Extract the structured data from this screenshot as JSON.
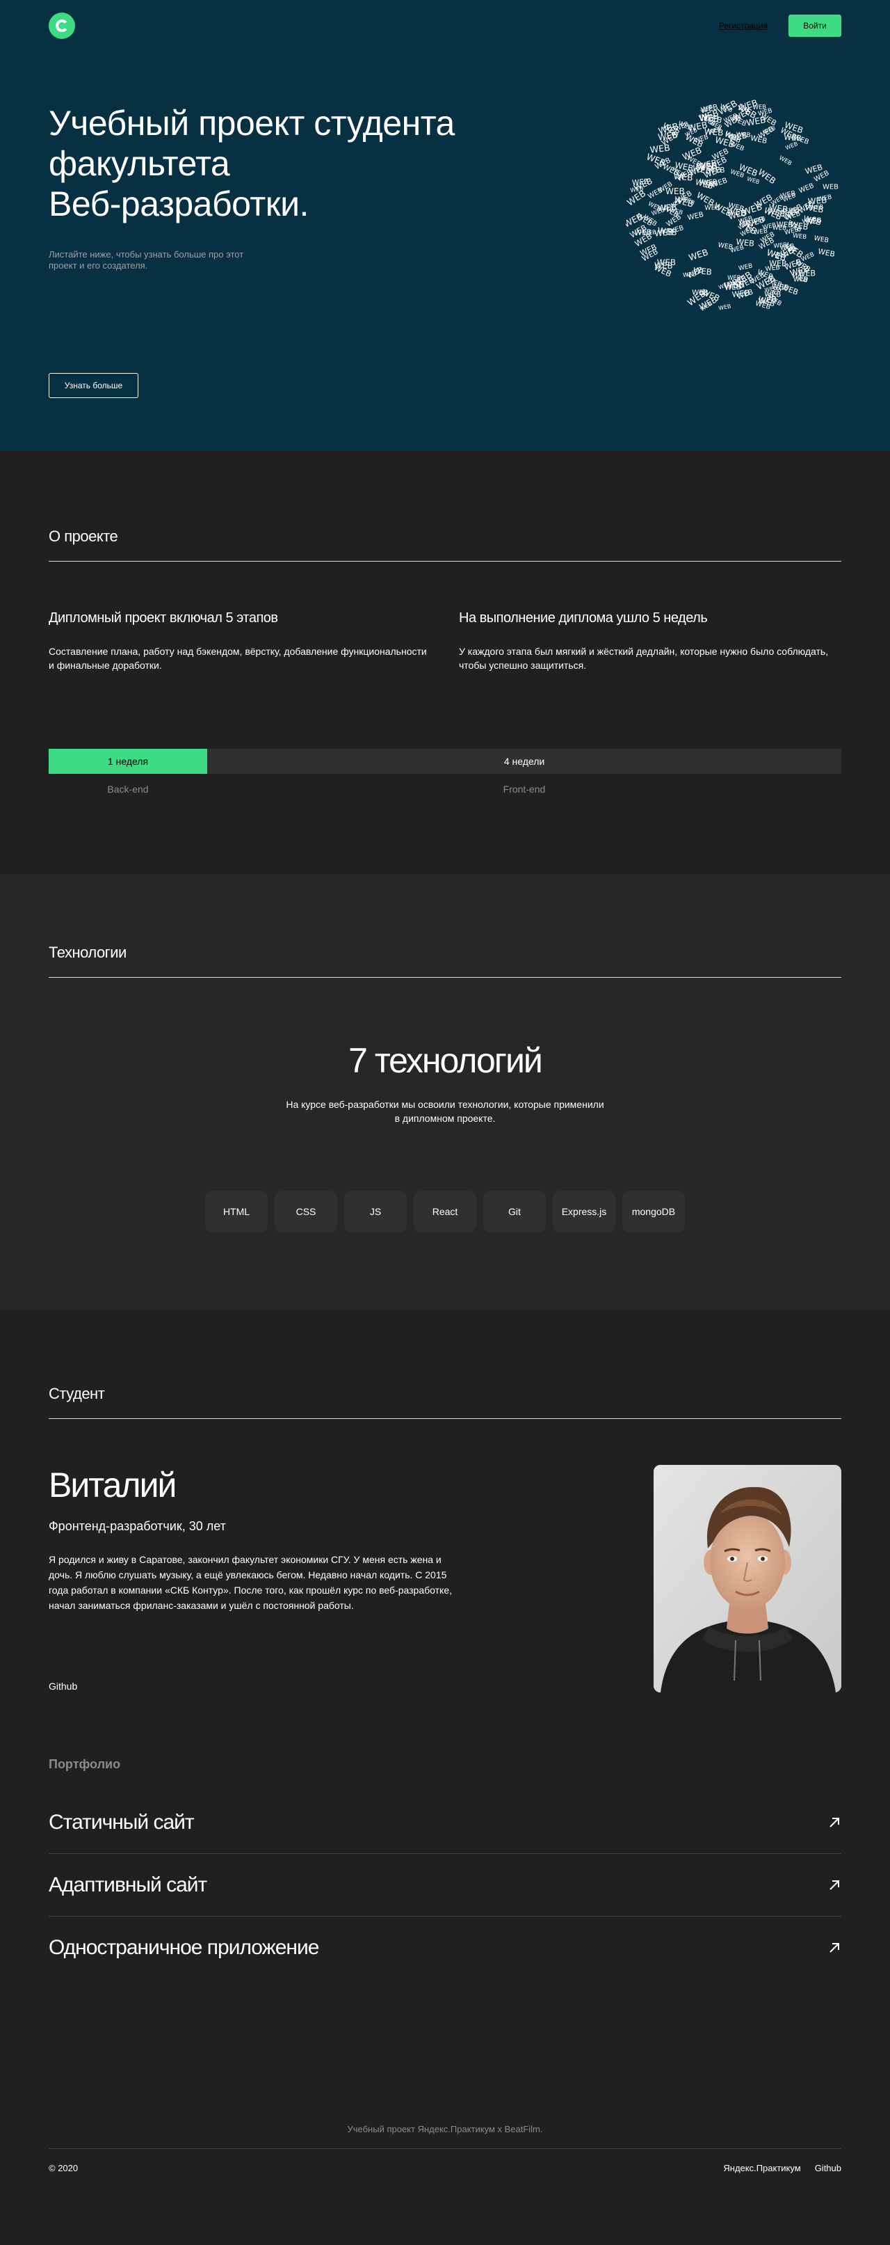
{
  "header": {
    "register_label": "Регистрация",
    "login_label": "Войти"
  },
  "hero": {
    "title_line1": "Учебный проект студента",
    "title_line2": "факультета",
    "title_line3": "Веб-разработки.",
    "subtitle": "Листайте ниже, чтобы узнать больше про этот проект и его создателя.",
    "button_label": "Узнать больше",
    "art_word": "WEB"
  },
  "about": {
    "title": "О проекте",
    "col1_title": "Дипломный проект включал 5 этапов",
    "col1_text": "Составление плана, работу над бэкендом, вёрстку, добавление функциональности и финальные доработки.",
    "col2_title": "На выполнение диплома ушло 5 недель",
    "col2_text": "У каждого этапа был мягкий и жёсткий дедлайн, которые нужно было соблюдать, чтобы успешно защититься.",
    "timeline": {
      "back_duration": "1 неделя",
      "back_label": "Back-end",
      "front_duration": "4 недели",
      "front_label": "Front-end"
    }
  },
  "tech": {
    "title": "Технологии",
    "headline": "7 технологий",
    "text": "На курсе веб-разработки мы освоили технологии, которые применили в дипломном проекте.",
    "items": [
      "HTML",
      "CSS",
      "JS",
      "React",
      "Git",
      "Express.js",
      "mongoDB"
    ]
  },
  "student": {
    "title": "Студент",
    "name": "Виталий",
    "job": "Фронтенд-разработчик, 30 лет",
    "bio": "Я родился и живу в Саратове, закончил факультет экономики СГУ. У меня есть жена и дочь. Я люблю слушать музыку, а ещё увлекаюсь бегом. Недавно начал кодить. С 2015 года работал в компании «СКБ Контур». После того, как прошёл курс по веб-разработке, начал заниматься фриланс-заказами и ушёл с постоянной работы.",
    "github_label": "Github"
  },
  "portfolio": {
    "title": "Портфолио",
    "items": [
      "Статичный сайт",
      "Адаптивный сайт",
      "Одностраничное приложение"
    ]
  },
  "footer": {
    "top_text": "Учебный проект Яндекс.Практикум х BeatFilm.",
    "copyright": "© 2020",
    "links": [
      "Яндекс.Практикум",
      "Github"
    ]
  },
  "colors": {
    "accent": "#3DDC84",
    "hero_bg": "#073042",
    "page_bg": "#202020",
    "tech_bg": "#272727"
  }
}
